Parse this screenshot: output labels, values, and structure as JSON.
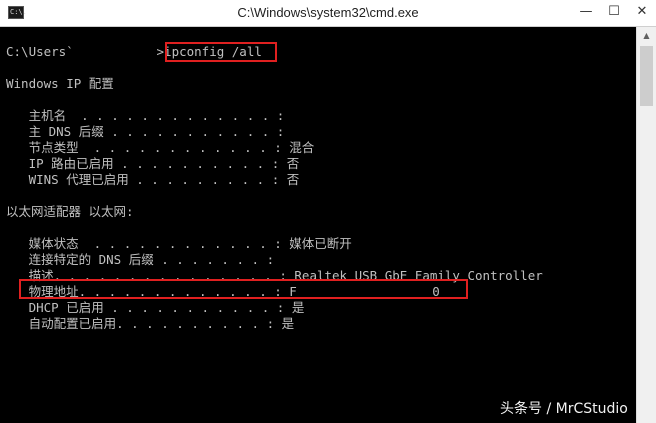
{
  "window": {
    "title": "C:\\Windows\\system32\\cmd.exe",
    "app_icon_text": "C:\\.",
    "controls": {
      "minimize": "—",
      "maximize": "☐",
      "close": "✕"
    }
  },
  "console": {
    "prompt": "C:\\Users`           >",
    "command": "ipconfig /all",
    "lines": [
      "Windows IP 配置",
      "   主机名  . . . . . . . . . . . . . :",
      "   主 DNS 后缀 . . . . . . . . . . . :",
      "   节点类型  . . . . . . . . . . . . : 混合",
      "   IP 路由已启用 . . . . . . . . . . : 否",
      "   WINS 代理已启用 . . . . . . . . . : 否",
      "以太网适配器 以太网:",
      "   媒体状态  . . . . . . . . . . . . : 媒体已断开",
      "   连接特定的 DNS 后缀 . . . . . . . :",
      "   描述. . . . . . . . . . . . . . . : Realtek USB GbE Family Controller",
      "   物理地址. . . . . . . . . . . . . : F                  0",
      "   DHCP 已启用 . . . . . . . . . . . : 是",
      "   自动配置已启用. . . . . . . . . . : 是"
    ]
  },
  "watermark": "头条号 / MrCStudio"
}
